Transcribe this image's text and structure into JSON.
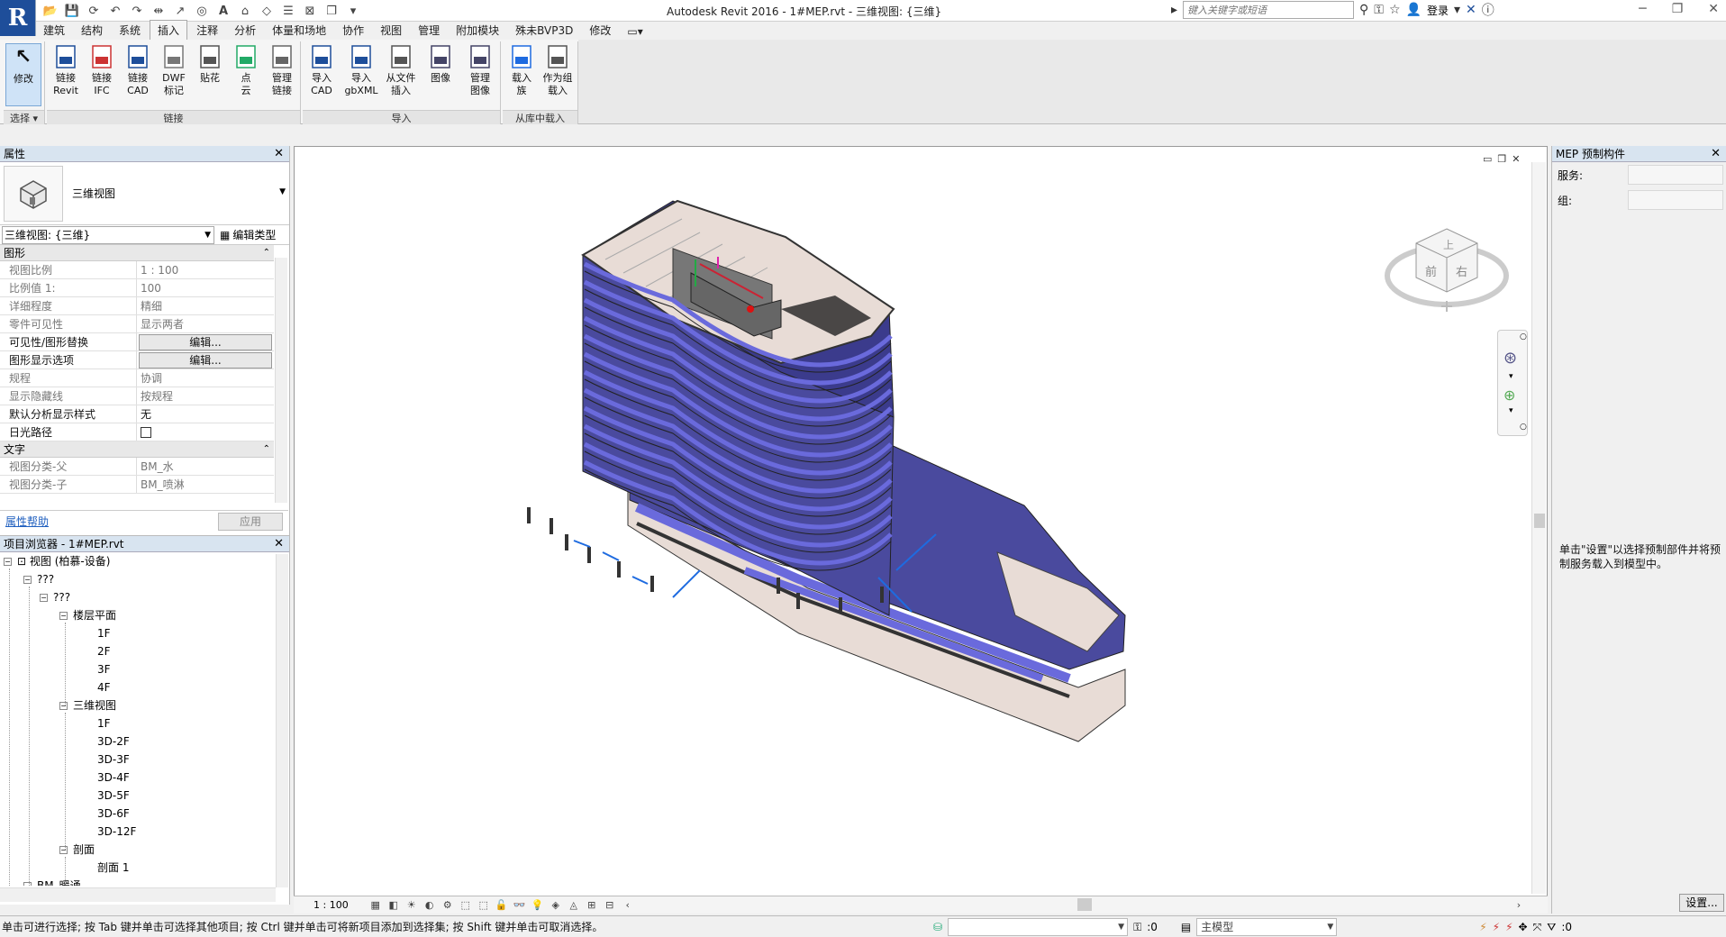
{
  "app": {
    "title": "Autodesk Revit 2016 -     1#MEP.rvt - 三维视图: {三维}",
    "logo": "R",
    "search_placeholder": "键入关键字或短语",
    "login": "登录"
  },
  "ribbon": {
    "tabs": [
      "建筑",
      "结构",
      "系统",
      "插入",
      "注释",
      "分析",
      "体量和场地",
      "协作",
      "视图",
      "管理",
      "附加模块",
      "殊未BVP3D",
      "修改"
    ],
    "active_tab": "插入",
    "panels": {
      "select": {
        "label": "选择",
        "modify": "修改"
      },
      "link": {
        "label": "链接",
        "buttons": [
          {
            "line1": "链接",
            "line2": "Revit",
            "icon": "RVT"
          },
          {
            "line1": "链接",
            "line2": "IFC",
            "icon": "IFC"
          },
          {
            "line1": "链接",
            "line2": "CAD",
            "icon": "CAD"
          },
          {
            "line1": "DWF",
            "line2": "标记",
            "icon": "DWF"
          },
          {
            "line1": "贴花",
            "line2": "",
            "icon": "decal"
          },
          {
            "line1": "点",
            "line2": "云",
            "icon": "cloud"
          },
          {
            "line1": "管理",
            "line2": "链接",
            "icon": "manage"
          }
        ]
      },
      "import": {
        "label": "导入",
        "buttons": [
          {
            "line1": "导入",
            "line2": "CAD",
            "icon": "CAD"
          },
          {
            "line1": "导入",
            "line2": "gbXML",
            "icon": "XML"
          },
          {
            "line1": "从文件",
            "line2": "插入",
            "icon": "file"
          },
          {
            "line1": "图像",
            "line2": "",
            "icon": "image"
          },
          {
            "line1": "管理",
            "line2": "图像",
            "icon": "image"
          }
        ]
      },
      "load": {
        "label": "从库中载入",
        "buttons": [
          {
            "line1": "载入",
            "line2": "族",
            "icon": "family"
          },
          {
            "line1": "作为组",
            "line2": "载入",
            "icon": "group"
          }
        ]
      }
    }
  },
  "properties": {
    "title": "属性",
    "type_name": "三维视图",
    "instance": "三维视图: {三维}",
    "edit_type": "编辑类型",
    "groups": [
      {
        "name": "图形",
        "rows": [
          {
            "key": "视图比例",
            "value": "1 : 100",
            "dim": true
          },
          {
            "key": "比例值 1:",
            "value": "100",
            "dim": true
          },
          {
            "key": "详细程度",
            "value": "精细",
            "dim": true
          },
          {
            "key": "零件可见性",
            "value": "显示两者",
            "dim": true
          },
          {
            "key": "可见性/图形替换",
            "value": "编辑...",
            "dim": false,
            "button": true
          },
          {
            "key": "图形显示选项",
            "value": "编辑...",
            "dim": false,
            "button": true
          },
          {
            "key": "规程",
            "value": "协调",
            "dim": true
          },
          {
            "key": "显示隐藏线",
            "value": "按规程",
            "dim": true
          },
          {
            "key": "默认分析显示样式",
            "value": "无",
            "dim": false
          },
          {
            "key": "日光路径",
            "value": "",
            "dim": false,
            "checkbox": true
          }
        ]
      },
      {
        "name": "文字",
        "rows": [
          {
            "key": "视图分类-父",
            "value": "BM_水",
            "dim": true
          },
          {
            "key": "视图分类-子",
            "value": "BM_喷淋",
            "dim": true
          }
        ]
      }
    ],
    "help": "属性帮助",
    "apply": "应用"
  },
  "browser": {
    "title": "项目浏览器 - 1#MEP.rvt",
    "root": "视图 (柏慕-设备)",
    "l1": "???",
    "l2": "???",
    "floor_plans": "楼层平面",
    "floors": [
      "1F",
      "2F",
      "3F",
      "4F"
    ],
    "views3d": "三维视图",
    "views3d_items": [
      "1F",
      "3D-2F",
      "3D-3F",
      "3D-4F",
      "3D-5F",
      "3D-6F",
      "3D-12F"
    ],
    "sections": "剖面",
    "section_items": [
      "剖面 1"
    ],
    "bm": "BM_暖通"
  },
  "viewbar": {
    "scale": "1 : 100"
  },
  "viewcube": {
    "top": "上",
    "front": "前",
    "right": "右"
  },
  "mep": {
    "title": "MEP 预制构件",
    "service_label": "服务:",
    "group_label": "组:",
    "description": "单击\"设置\"以选择预制部件并将预制服务载入到模型中。",
    "settings": "设置..."
  },
  "status": {
    "text": "单击可进行选择; 按 Tab 键并单击可选择其他项目; 按 Ctrl 键并单击可将新项目添加到选择集; 按 Shift 键并单击可取消选择。",
    "worksets": ":0",
    "model": "主模型",
    "filter": ":0"
  },
  "colors": {
    "facade": "#4a4a9e",
    "slab": "#6a6adc",
    "roof": "#e8dcd6",
    "accent": "#1e4e9a"
  }
}
